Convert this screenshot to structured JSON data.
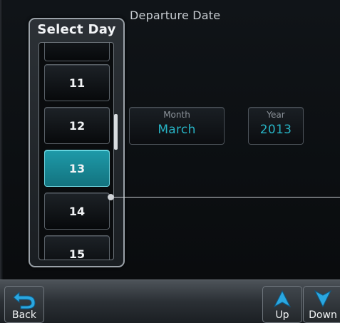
{
  "screen": {
    "title": "Departure Date"
  },
  "day_picker": {
    "title": "Select Day",
    "days": [
      "11",
      "12",
      "13",
      "14",
      "15"
    ],
    "selected": "13"
  },
  "fields": {
    "month": {
      "label": "Month",
      "value": "March"
    },
    "year": {
      "label": "Year",
      "value": "2013"
    }
  },
  "bottom_bar": {
    "back_label": "Back",
    "up_label": "Up",
    "down_label": "Down"
  },
  "icons": {
    "back": "back-arrow-icon",
    "up": "up-arrow-icon",
    "down": "down-arrow-icon"
  },
  "colors": {
    "accent": "#1e9aa9",
    "value_text": "#27b3c4"
  }
}
